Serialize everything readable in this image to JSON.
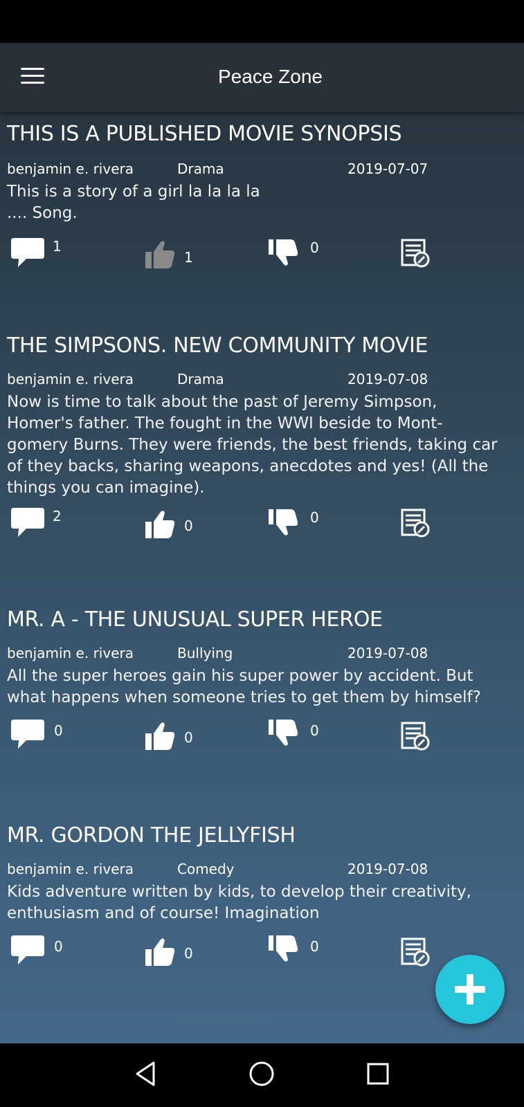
{
  "app": {
    "title": "Peace Zone"
  },
  "posts": [
    {
      "title": "THIS IS A PUBLISHED MOVIE SYNOPSIS",
      "author": "benjamin e. rivera",
      "genre": "Drama",
      "date": "2019-07-07",
      "synopsis": "This is a story of a girl la la la la\n.... Song.",
      "comments": "1",
      "likes": "1",
      "dislikes": "0",
      "liked": true
    },
    {
      "title": "THE SIMPSONS. NEW COMMUNITY MOVIE",
      "author": "benjamin e. rivera",
      "genre": "Drama",
      "date": "2019-07-08",
      "synopsis": "Now is time to talk about the past of Jeremy Simpson,\nHomer's father. The fought in the WWI beside to Mont-\ngomery Burns. They were friends, the best friends, taking car\nof they backs, sharing weapons, anecdotes and yes! (All the\nthings you can imagine).",
      "comments": "2",
      "likes": "0",
      "dislikes": "0",
      "liked": false
    },
    {
      "title": "MR. A - THE UNUSUAL SUPER HEROE",
      "author": "benjamin e. rivera",
      "genre": "Bullying",
      "date": "2019-07-08",
      "synopsis": "All the super heroes gain his super power by accident. But\nwhat happens when someone tries to get them by himself?",
      "comments": "0",
      "likes": "0",
      "dislikes": "0",
      "liked": false
    },
    {
      "title": "MR. GORDON THE JELLYFISH",
      "author": "benjamin e. rivera",
      "genre": "Comedy",
      "date": "2019-07-08",
      "synopsis": "Kids adventure written by kids, to develop their creativity,\nenthusiasm and of course! Imagination",
      "comments": "0",
      "likes": "0",
      "dislikes": "0",
      "liked": false
    }
  ],
  "icons": {
    "comment": "comment-icon",
    "like": "thumbs-up-icon",
    "dislike": "thumbs-down-icon",
    "review": "review-icon",
    "add": "plus-icon",
    "nav_back": "back-triangle-icon",
    "nav_home": "home-circle-icon",
    "nav_recents": "recents-square-icon"
  },
  "colors": {
    "fab": "#26c6da",
    "app_bar": "#2a3038",
    "like_inactive": "#8a8a8a"
  }
}
